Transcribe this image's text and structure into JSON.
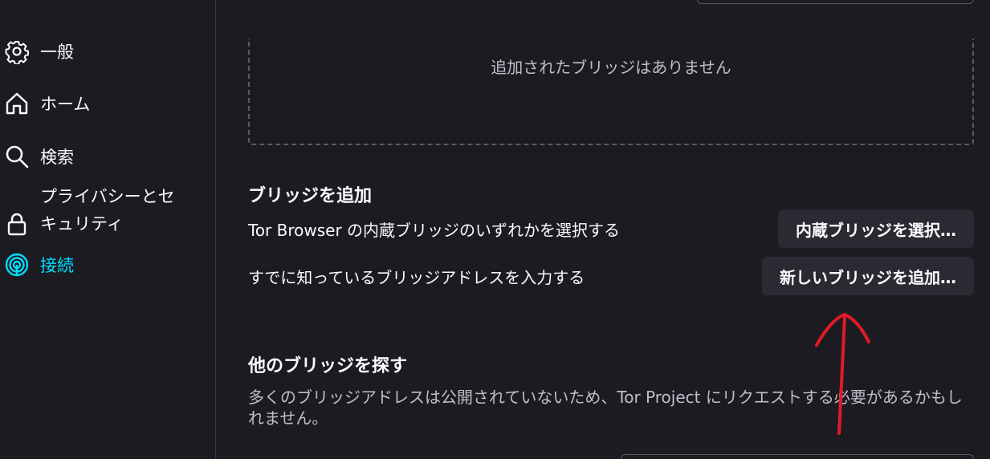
{
  "sidebar": {
    "items": [
      {
        "label": "一般",
        "icon": "gear-icon"
      },
      {
        "label": "ホーム",
        "icon": "home-icon"
      },
      {
        "label": "検索",
        "icon": "search-icon"
      },
      {
        "label": "プライバシーとセキュリティ",
        "icon": "lock-icon"
      },
      {
        "label": "接続",
        "icon": "connection-icon",
        "active": true
      }
    ]
  },
  "bridges": {
    "empty_text": "追加されたブリッジはありません"
  },
  "add_bridge": {
    "heading": "ブリッジを追加",
    "builtin_text": "Tor Browser の内蔵ブリッジのいずれかを選択する",
    "builtin_button": "内蔵ブリッジを選択…",
    "known_text": "すでに知っているブリッジアドレスを入力する",
    "new_button": "新しいブリッジを追加…"
  },
  "find_bridges": {
    "heading": "他のブリッジを探す",
    "description": "多くのブリッジアドレスは公開されていないため、Tor Project にリクエストする必要があるかもしれません。"
  },
  "colors": {
    "background": "#1c1b22",
    "accent": "#00ddff",
    "button_bg": "#2b2a33",
    "annotation": "#e01b24"
  }
}
